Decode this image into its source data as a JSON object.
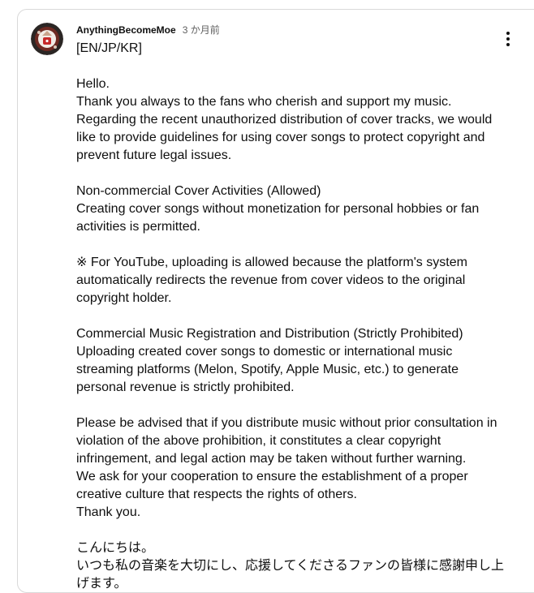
{
  "comment": {
    "author": "AnythingBecomeMoe",
    "time": "3 か月前",
    "text": "[EN/JP/KR]\n\nHello.\nThank you always to the fans who cherish and support my music.\nRegarding the recent unauthorized distribution of cover tracks, we would like to provide guidelines for using cover songs to protect copyright and prevent future legal issues.\n\nNon-commercial Cover Activities (Allowed)\nCreating cover songs without monetization for personal hobbies or fan activities is permitted.\n\n※ For YouTube, uploading is allowed because the platform's system automatically redirects the revenue from cover videos to the original copyright holder.\n\nCommercial Music Registration and Distribution (Strictly Prohibited)\nUploading created cover songs to domestic or international music streaming platforms (Melon, Spotify, Apple Music, etc.) to generate personal revenue is strictly prohibited.\n\nPlease be advised that if you distribute music without prior consultation in violation of the above prohibition, it constitutes a clear copyright infringement, and legal action may be taken without further warning.\nWe ask for your cooperation to ensure the establishment of a proper creative culture that respects the rights of others.\nThank you.\n\nこんにちは。\nいつも私の音楽を大切にし、応援してくださるファンの皆様に感謝申し上げます。",
    "menu_icon": "more-vert-icon",
    "avatar_icon": "avatar-icon"
  },
  "colors": {
    "author": "#0f0f0f",
    "time": "#606060",
    "border": "#d9d9d9"
  }
}
